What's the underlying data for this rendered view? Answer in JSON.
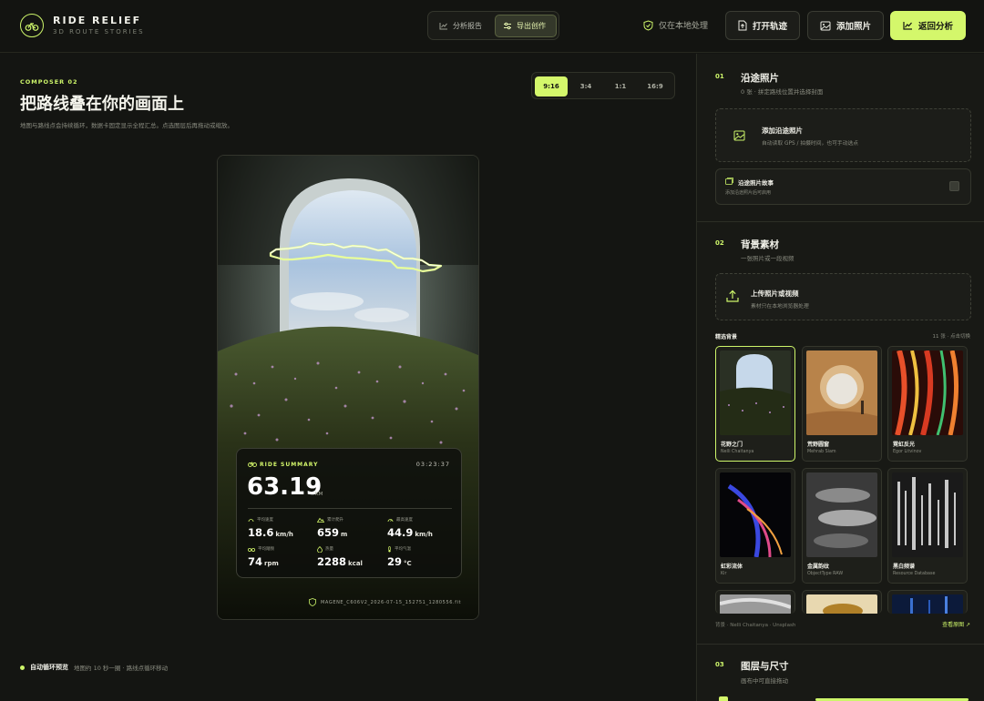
{
  "app": {
    "brand": "RIDE RELIEF",
    "subtitle": "3D ROUTE STORIES"
  },
  "nav": {
    "tabs": [
      {
        "label": "分析报告"
      },
      {
        "label": "导出创作"
      }
    ]
  },
  "header": {
    "local_label": "仅在本地处理",
    "open_track": "打开轨迹",
    "add_photo": "添加照片",
    "back_analysis": "返回分析"
  },
  "composer": {
    "kicker": "COMPOSER 02",
    "title": "把路线叠在你的画面上",
    "description": "地图与路线点会持续循环，数据卡固定显示全程汇总。点选图层后再拖动或缩放。",
    "ratios": [
      "9:16",
      "3:4",
      "1:1",
      "16:9"
    ],
    "selected_ratio": "9:16"
  },
  "summary": {
    "label": "RIDE SUMMARY",
    "duration": "03:23:37",
    "distance": "63.19",
    "distance_unit": "KM",
    "stats": [
      {
        "label": "平均速度",
        "value": "18.6",
        "unit": "km/h"
      },
      {
        "label": "累计爬升",
        "value": "659",
        "unit": "m"
      },
      {
        "label": "最高速度",
        "value": "44.9",
        "unit": "km/h"
      },
      {
        "label": "平均踏频",
        "value": "74",
        "unit": "rpm"
      },
      {
        "label": "热量",
        "value": "2288",
        "unit": "kcal"
      },
      {
        "label": "平均气温",
        "value": "29",
        "unit": "°C"
      }
    ],
    "file": "MAGENE_C606V2_2026-07-15_152751_1280556.fit"
  },
  "loop": {
    "label": "自动循环预览",
    "desc": "地图约 10 秒一圈 · 路线点循环移动"
  },
  "panel": {
    "s1": {
      "num": "01",
      "title": "沿途照片",
      "sub": "0 张 · 拼定路线位置并选择封面",
      "add_title": "添加沿途照片",
      "add_sub": "自动读取 GPS / 拍摄时间，也可手动选点",
      "story_title": "沿途照片故事",
      "story_sub": "添加沿途照片后可启用"
    },
    "s2": {
      "num": "02",
      "title": "背景素材",
      "sub": "一张照片或一段视频",
      "upload_title": "上传照片或视频",
      "upload_sub": "素材只在本地浏览器处理",
      "featured": "精选背景",
      "featured_count": "11 张 · 点击切换",
      "thumbs": [
        {
          "name": "花野之门",
          "credit": "Nelli Chaitanya"
        },
        {
          "name": "荒野圆窗",
          "credit": "Mehrab Siam"
        },
        {
          "name": "霓虹反光",
          "credit": "Egor Litvinov"
        },
        {
          "name": "虹彩流体",
          "credit": "Kir"
        },
        {
          "name": "金属韵纹",
          "credit": "ObjectType RAW"
        },
        {
          "name": "黑白频谱",
          "credit": "Resource Database"
        }
      ],
      "credit_line": "背景 · Nelli Chaitanya · Unsplash",
      "view_source": "查看原图 ↗"
    },
    "s3": {
      "num": "03",
      "title": "图层与尺寸",
      "sub": "画布中可直接拖动"
    }
  },
  "colors": {
    "accent": "#d4f76b",
    "bg": "#141512"
  }
}
